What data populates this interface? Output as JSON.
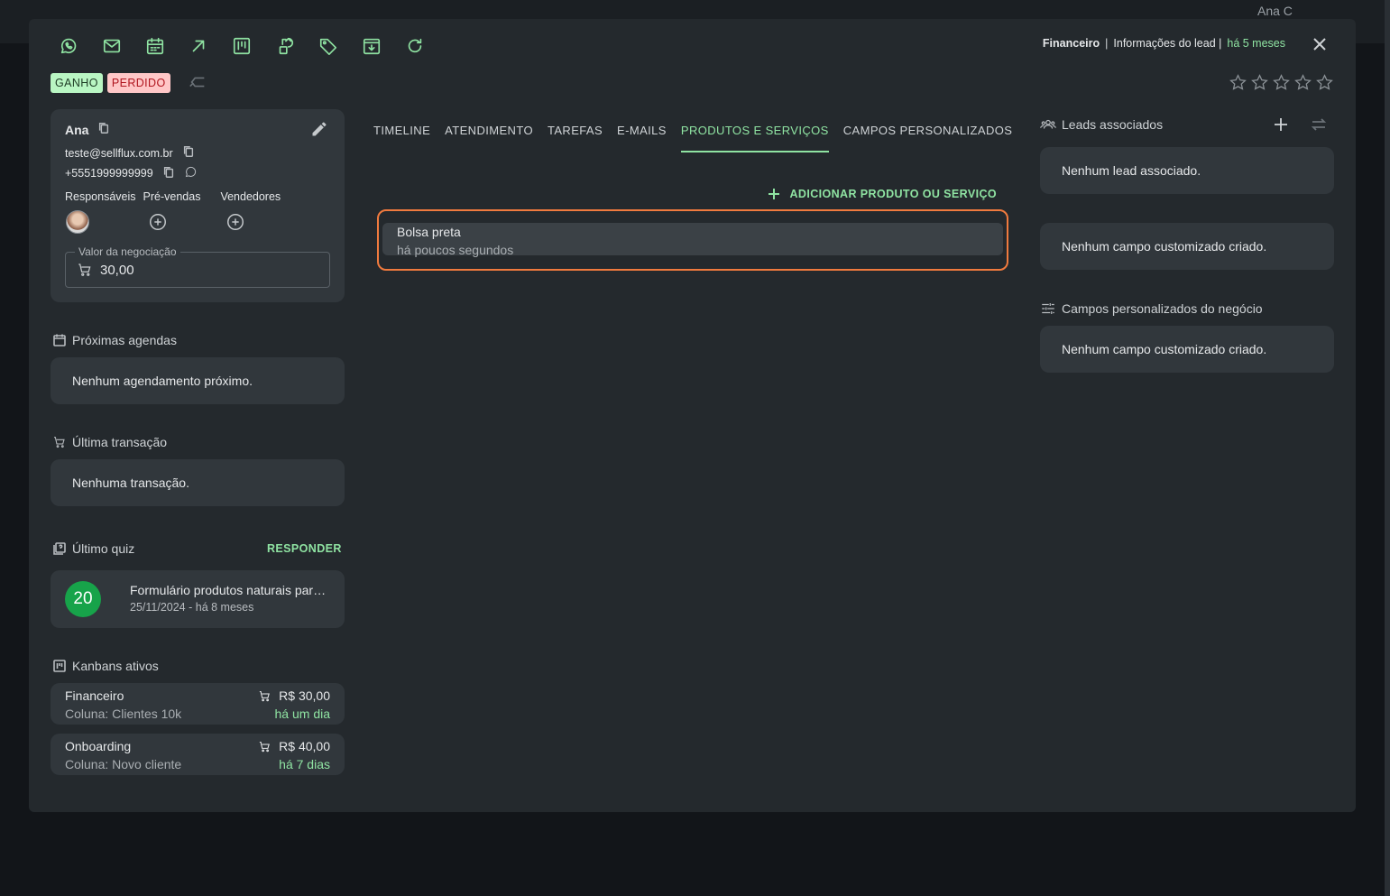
{
  "background": {
    "user_name": "Ana C"
  },
  "header": {
    "kanban": "Financeiro",
    "separator": "|",
    "info": "Informações do lead |",
    "time": "há 5 meses"
  },
  "badges": {
    "won": "GANHO",
    "lost": "PERDIDO"
  },
  "lead": {
    "name": "Ana",
    "email": "teste@sellflux.com.br",
    "phone": "+5551999999999",
    "roles": [
      "Responsáveis",
      "Pré-vendas",
      "Vendedores"
    ],
    "negotiation_label": "Valor da negociação",
    "negotiation_value": "30,00"
  },
  "sections": {
    "agendas_title": "Próximas agendas",
    "agendas_empty": "Nenhum agendamento próximo.",
    "transaction_title": "Última transação",
    "transaction_empty": "Nenhuma transação.",
    "quiz_title": "Último quiz",
    "quiz_action": "RESPONDER",
    "kanbans_title": "Kanbans ativos"
  },
  "quiz": {
    "score": "20",
    "title": "Formulário produtos naturais para emagrecimento",
    "date": "25/11/2024 - há 8 meses"
  },
  "kanbans": [
    {
      "name": "Financeiro",
      "column": "Coluna: Clientes 10k",
      "price": "R$ 30,00",
      "time": "há um dia"
    },
    {
      "name": "Onboarding",
      "column": "Coluna: Novo cliente",
      "price": "R$ 40,00",
      "time": "há 7 dias"
    }
  ],
  "tabs": [
    "TIMELINE",
    "ATENDIMENTO",
    "TAREFAS",
    "E-MAILS",
    "PRODUTOS E SERVIÇOS",
    "CAMPOS PERSONALIZADOS"
  ],
  "active_tab": "PRODUTOS E SERVIÇOS",
  "products": {
    "add_label": "ADICIONAR PRODUTO OU SERVIÇO",
    "items": [
      {
        "name": "Bolsa preta",
        "time": "há poucos segundos"
      }
    ]
  },
  "right": {
    "associated_title": "Leads associados",
    "associated_empty": "Nenhum lead associado.",
    "custom_empty": "Nenhum campo customizado criado.",
    "business_title": "Campos personalizados do negócio",
    "business_empty": "Nenhum campo customizado criado."
  },
  "colors": {
    "accent": "#8fe3a2",
    "highlight": "#f07a3e",
    "won_bg": "#b9f6c3",
    "lost_bg": "#ffc7c7"
  },
  "icons": [
    "whatsapp-icon",
    "mail-icon",
    "calendar-icon",
    "arrow-up-right-icon",
    "kanban-icon",
    "transfer-icon",
    "tag-icon",
    "archive-icon",
    "refresh-icon"
  ]
}
